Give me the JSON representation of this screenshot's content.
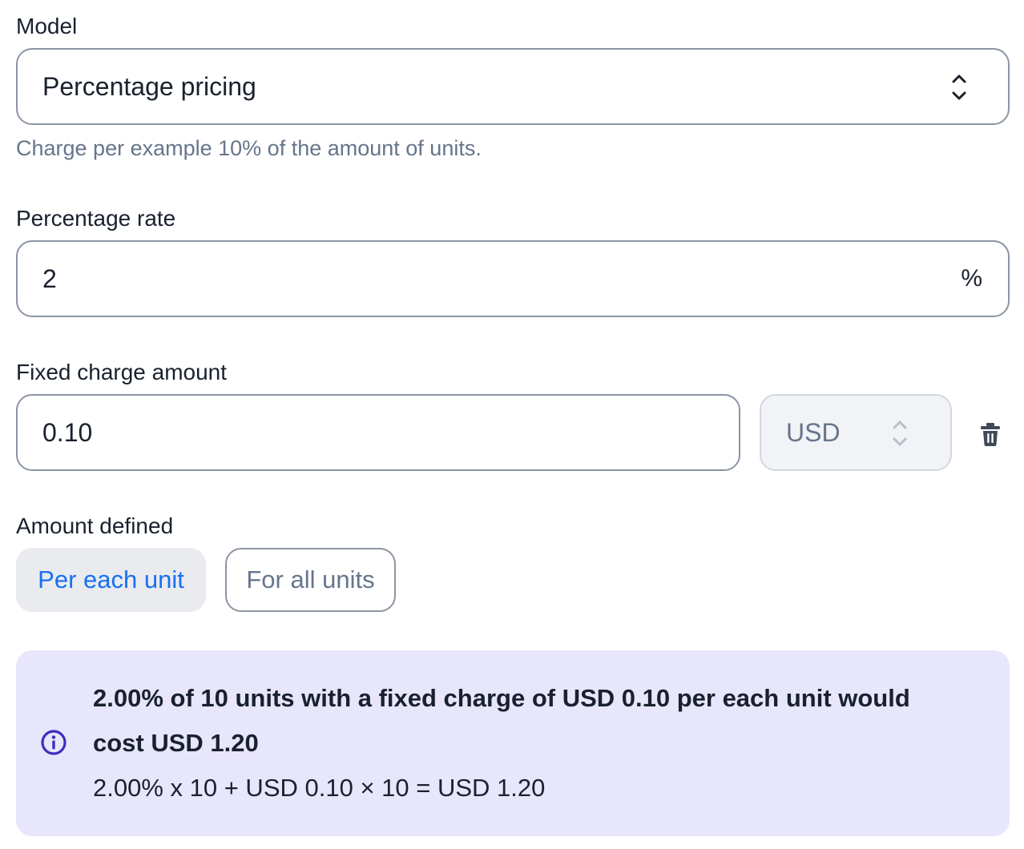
{
  "model": {
    "label": "Model",
    "selected": "Percentage pricing",
    "help": "Charge per example 10% of the amount of units."
  },
  "percentage_rate": {
    "label": "Percentage rate",
    "value": "2",
    "suffix": "%"
  },
  "fixed_charge": {
    "label": "Fixed charge amount",
    "value": "0.10",
    "currency": "USD"
  },
  "amount_defined": {
    "label": "Amount defined",
    "options": [
      "Per each unit",
      "For all units"
    ],
    "selected": "Per each unit"
  },
  "info": {
    "line1": "2.00% of 10 units with a fixed charge of USD 0.10 per each unit would",
    "line2": "cost USD 1.20",
    "formula": "2.00% x 10 + USD 0.10 × 10 = USD 1.20"
  },
  "colors": {
    "accent": "#1a6ff2",
    "info_background": "#e8e6fc",
    "info_icon": "#3d2ebd",
    "border": "#8c95a3",
    "muted_text": "#66758c"
  },
  "icons": {
    "select_chevrons": "chevron-up-down-icon",
    "delete": "trash-icon",
    "info": "info-circle-icon"
  }
}
